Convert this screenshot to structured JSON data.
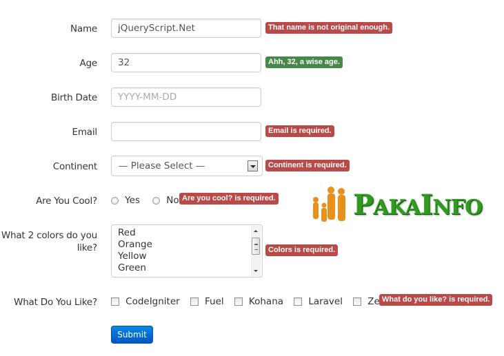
{
  "form": {
    "name": {
      "label": "Name",
      "value": "jQueryScript.Net",
      "message": "That name is not original enough.",
      "status": "error"
    },
    "age": {
      "label": "Age",
      "value": "32",
      "message": "Ahh, 32, a wise age.",
      "status": "success"
    },
    "birth_date": {
      "label": "Birth Date",
      "value": "",
      "placeholder": "YYYY-MM-DD"
    },
    "email": {
      "label": "Email",
      "value": "",
      "message": "Email is required.",
      "status": "error"
    },
    "continent": {
      "label": "Continent",
      "selected": "— Please Select —",
      "message": "Continent is required.",
      "status": "error"
    },
    "cool": {
      "label": "Are You Cool?",
      "options": [
        "Yes",
        "No"
      ],
      "message": "Are you cool? is required.",
      "status": "error"
    },
    "colors": {
      "label": "What 2 colors do you like?",
      "options": [
        "Red",
        "Orange",
        "Yellow",
        "Green"
      ],
      "message": "Colors is required.",
      "status": "error"
    },
    "likes": {
      "label": "What Do You Like?",
      "options": [
        "CodeIgniter",
        "Fuel",
        "Kohana",
        "Laravel",
        "Zend"
      ],
      "message": "What do you like? is required.",
      "status": "error"
    },
    "submit_label": "Submit"
  },
  "logo": {
    "text_p": "P",
    "text_aka": "AKA",
    "text_i": "I",
    "text_nfo": "NFO"
  },
  "colors": {
    "error": "#b94a48",
    "success": "#468847",
    "button": "#0a6fd6",
    "logo_green": "#2f9a1c",
    "logo_orange": "#e8901c"
  }
}
